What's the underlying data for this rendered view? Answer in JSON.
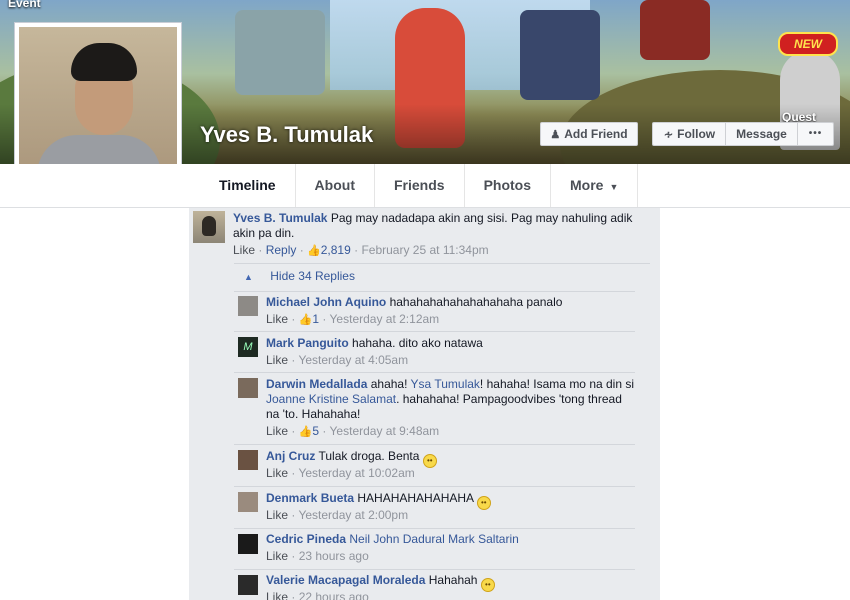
{
  "cover": {
    "event_text": "Event",
    "new_badge": "NEW",
    "quest_text": "Quest"
  },
  "profile": {
    "name": "Yves B. Tumulak"
  },
  "actions": {
    "add_friend": "Add Friend",
    "follow": "Follow",
    "message": "Message",
    "more": "•••"
  },
  "tabs": [
    {
      "label": "Timeline"
    },
    {
      "label": "About"
    },
    {
      "label": "Friends"
    },
    {
      "label": "Photos"
    },
    {
      "label": "More"
    }
  ],
  "post": {
    "author": "Yves B. Tumulak",
    "text": "Pag may nadadapa akin ang sisi. Pag may nahuling adik akin pa din.",
    "like": "Like",
    "reply": "Reply",
    "likes": "2,819",
    "time": "February 25 at 11:34pm",
    "hide_replies": "Hide 34 Replies"
  },
  "replies": [
    {
      "author": "Michael John Aquino",
      "text": "hahahahahahahahahaha panalo",
      "like": "Like",
      "likes": "1",
      "time": "Yesterday at 2:12am"
    },
    {
      "author": "Mark Panguito",
      "text": "hahaha. dito ako natawa",
      "like": "Like",
      "time": "Yesterday at 4:05am"
    },
    {
      "author": "Darwin Medallada",
      "text_a": "ahaha!",
      "mention1": "Ysa Tumulak",
      "text_b": "! hahaha! Isama mo na din si",
      "mention2": "Joanne Kristine Salamat",
      "text_c": ". hahahaha! Pampagoodvibes 'tong thread na 'to. Hahahaha!",
      "like": "Like",
      "likes": "5",
      "time": "Yesterday at 9:48am"
    },
    {
      "author": "Anj Cruz",
      "text": "Tulak droga. Benta",
      "like": "Like",
      "time": "Yesterday at 10:02am"
    },
    {
      "author": "Denmark Bueta",
      "text": "HAHAHAHAHAHAHA",
      "like": "Like",
      "time": "Yesterday at 2:00pm"
    },
    {
      "author": "Cedric Pineda",
      "mentions": "Neil John Dadural Mark Saltarin",
      "like": "Like",
      "time": "23 hours ago"
    },
    {
      "author": "Valerie Macapagal Moraleda",
      "text": "Hahahah",
      "like": "Like",
      "time": "22 hours ago"
    }
  ]
}
